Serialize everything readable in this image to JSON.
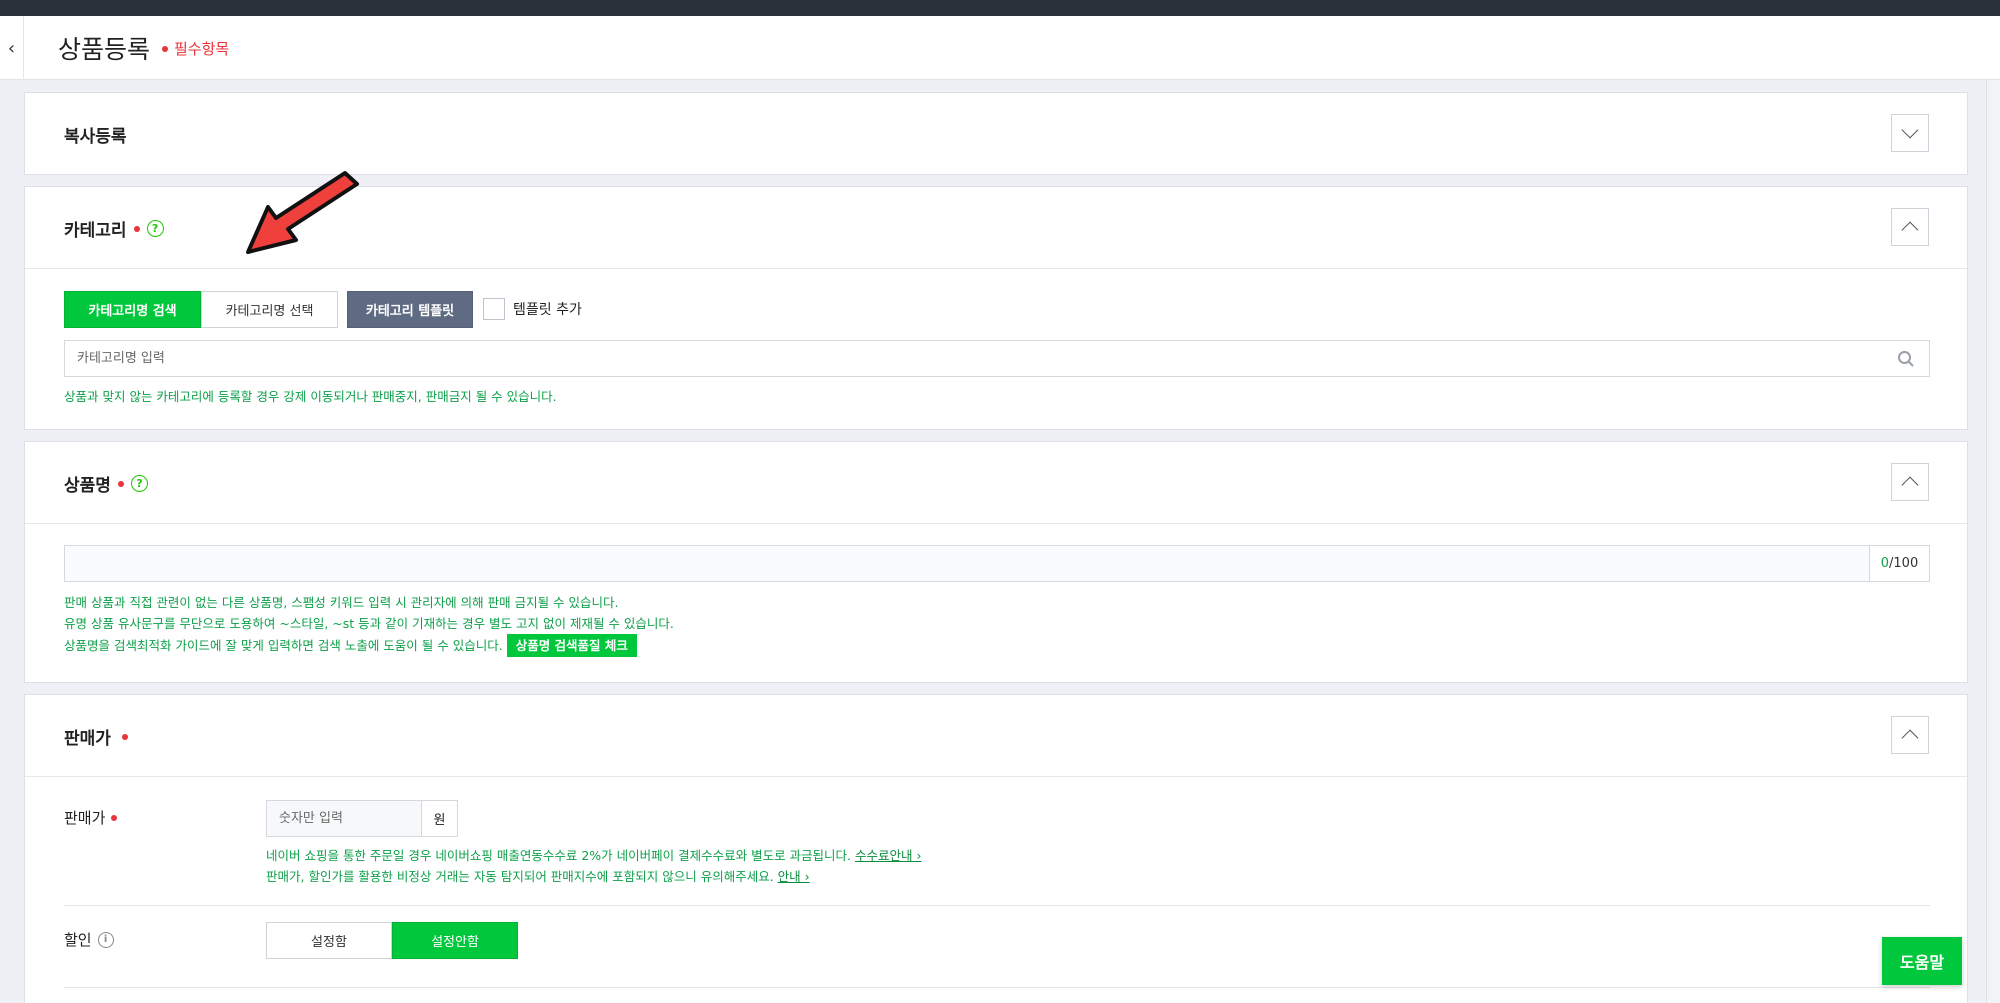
{
  "header": {
    "back_icon": "chevron-left-icon",
    "title": "상품등록",
    "required_note": "필수항목"
  },
  "copy_section": {
    "title": "복사등록"
  },
  "category_section": {
    "title": "카테고리",
    "tabs": [
      "카테고리명 검색",
      "카테고리명 선택"
    ],
    "template_button": "카테고리 템플릿",
    "template_add_label": "템플릿 추가",
    "search_placeholder": "카테고리명 입력",
    "note": "상품과 맞지 않는 카테고리에 등록할 경우 강제 이동되거나 판매중지, 판매금지 될 수 있습니다."
  },
  "product_name_section": {
    "title": "상품명",
    "input_value": "",
    "counter_current": "0",
    "counter_max": "/100",
    "notes": [
      "판매 상품과 직접 관련이 없는 다른 상품명, 스팸성 키워드 입력 시 관리자에 의해 판매 금지될 수 있습니다.",
      "유명 상품 유사문구를 무단으로 도용하여 ~스타일, ~st 등과 같이 기재하는 경우 별도 고지 없이 제재될 수 있습니다.",
      "상품명을 검색최적화 가이드에 잘 맞게 입력하면 검색 노출에 도움이 될 수 있습니다."
    ],
    "quality_check_button": "상품명 검색품질 체크"
  },
  "price_section": {
    "title": "판매가",
    "price_label": "판매가",
    "price_placeholder": "숫자만 입력",
    "currency_unit": "원",
    "note_line1": "네이버 쇼핑을 통한 주문일 경우 네이버쇼핑 매출연동수수료 2%가 네이버페이 결제수수료와 별도로 과금됩니다.",
    "note_line1_link": "수수료안내 ›",
    "note_line2": "판매가, 할인가를 활용한 비정상 거래는 자동 탐지되어 판매지수에 포함되지 않으니 유의해주세요.",
    "note_line2_link": "안내 ›",
    "discount_label": "할인",
    "discount_options": [
      "설정함",
      "설정안함"
    ],
    "discount_selected": "설정안함"
  },
  "help_button": "도움말",
  "colors": {
    "accent_green": "#00c73c",
    "required_red": "#e8343a",
    "note_green": "#0ea04a",
    "template_slate": "#5f6b82",
    "arrow_red": "#f0403c"
  }
}
